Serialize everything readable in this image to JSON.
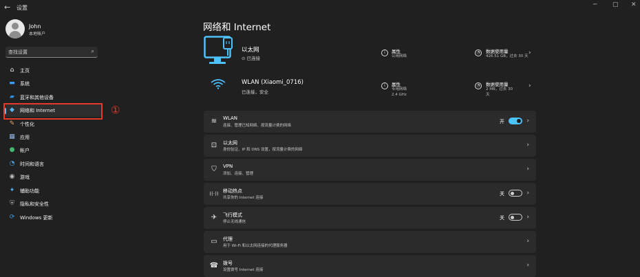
{
  "window": {
    "back_icon": "←",
    "title": "设置",
    "minimize_icon": "─",
    "maximize_icon": "▢",
    "close_icon": "✕"
  },
  "profile": {
    "name": "John",
    "account_type": "本地帐户"
  },
  "search": {
    "placeholder": "查找设置",
    "icon": "⌕"
  },
  "sidebar": {
    "items": [
      {
        "label": "主页",
        "icon": "home-icon",
        "glyph": "⌂",
        "color": "#f0f0f0"
      },
      {
        "label": "系统",
        "icon": "system-icon",
        "glyph": "▬",
        "color": "#3aa0ff"
      },
      {
        "label": "蓝牙和其他设备",
        "icon": "bluetooth-devices-icon",
        "glyph": "▰",
        "color": "#2f8fe0"
      },
      {
        "label": "网络和 Internet",
        "icon": "network-icon",
        "glyph": "◆",
        "color": "#58b6f0",
        "selected": true
      },
      {
        "label": "个性化",
        "icon": "personalization-icon",
        "glyph": "✎",
        "color": "#e8a56a"
      },
      {
        "label": "应用",
        "icon": "apps-icon",
        "glyph": "▦",
        "color": "#8fb8e8"
      },
      {
        "label": "帐户",
        "icon": "accounts-icon",
        "glyph": "●",
        "color": "#42b870"
      },
      {
        "label": "时间和语言",
        "icon": "time-language-icon",
        "glyph": "◔",
        "color": "#4ea7e8"
      },
      {
        "label": "游戏",
        "icon": "gaming-icon",
        "glyph": "◉",
        "color": "#bdbdbd"
      },
      {
        "label": "辅助功能",
        "icon": "accessibility-icon",
        "glyph": "✦",
        "color": "#55b4ee"
      },
      {
        "label": "隐私和安全性",
        "icon": "privacy-shield-icon",
        "glyph": "⛨",
        "color": "#a7a7a7"
      },
      {
        "label": "Windows 更新",
        "icon": "windows-update-icon",
        "glyph": "⟳",
        "color": "#3a9ee8"
      }
    ]
  },
  "annotation": {
    "number": "①",
    "color": "#e53a27"
  },
  "page": {
    "title": "网络和 Internet"
  },
  "connections": [
    {
      "name": "以太网",
      "status": "⊙ 已连接",
      "icon": "ethernet-icon",
      "properties_title": "属性",
      "properties_value": "公用网络",
      "usage_title": "数据使用量",
      "usage_value": "426.51 GB，过去 30 天"
    },
    {
      "name": "WLAN (Xiaomi_0716)",
      "status": "已连接，安全",
      "icon": "wifi-icon",
      "properties_title": "属性",
      "properties_value_1": "专用网络",
      "properties_value_2": "2.4 GHz",
      "usage_title": "数据使用量",
      "usage_value_1": "2 MB，过去 30",
      "usage_value_2": "天"
    }
  ],
  "settings_rows": [
    {
      "title": "WLAN",
      "subtitle": "连接、管理已知网络、按流量计费的网络",
      "icon": "wifi-icon",
      "glyph": "≋",
      "toggle_label": "开",
      "toggle_on": true
    },
    {
      "title": "以太网",
      "subtitle": "身份验证、IP 和 DNS 设置，按流量计费的网络",
      "icon": "ethernet-port-icon",
      "glyph": "⊡"
    },
    {
      "title": "VPN",
      "subtitle": "添加、连接、管理",
      "icon": "vpn-shield-icon",
      "glyph": "⛉"
    },
    {
      "title": "移动热点",
      "subtitle": "共享你的 Internet 连接",
      "icon": "hotspot-icon",
      "glyph": "((·))",
      "toggle_label": "关",
      "toggle_on": false
    },
    {
      "title": "飞行模式",
      "subtitle": "停止无线通信",
      "icon": "airplane-icon",
      "glyph": "✈",
      "toggle_label": "关",
      "toggle_on": false
    },
    {
      "title": "代理",
      "subtitle": "用于 Wi-Fi 和以太网连接的代理服务器",
      "icon": "proxy-icon",
      "glyph": "▭"
    },
    {
      "title": "拨号",
      "subtitle": "设置拨号 Internet 连接",
      "icon": "dialup-icon",
      "glyph": "☎"
    }
  ],
  "colors": {
    "accent": "#4cc2ff",
    "background": "#202020",
    "card": "#2b2b2b",
    "annotation": "#e53a27"
  }
}
